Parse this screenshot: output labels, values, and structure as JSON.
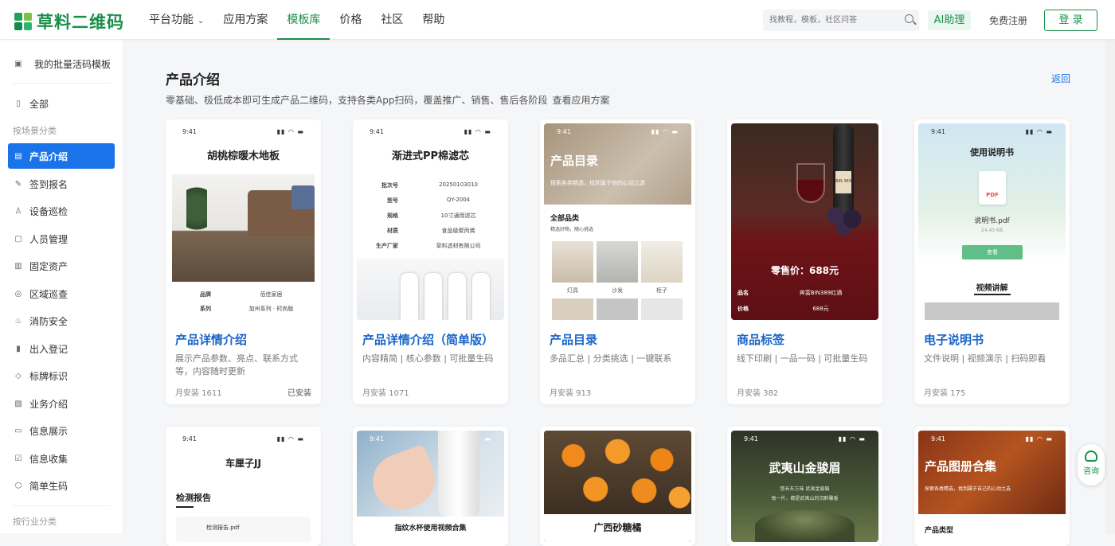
{
  "header": {
    "logo_text": "草料二维码",
    "nav": [
      {
        "label": "平台功能",
        "has_dropdown": true
      },
      {
        "label": "应用方案"
      },
      {
        "label": "模板库",
        "active": true
      },
      {
        "label": "价格"
      },
      {
        "label": "社区"
      },
      {
        "label": "帮助"
      }
    ],
    "search_placeholder": "找教程，模板，社区问答",
    "ai_label": "AI助理",
    "register_label": "免费注册",
    "login_label": "登 录"
  },
  "sidebar": {
    "top_item": "我的批量活码模板",
    "all_item": "全部",
    "category_scene": "按场景分类",
    "items": [
      {
        "label": "产品介绍",
        "active": true
      },
      {
        "label": "签到报名"
      },
      {
        "label": "设备巡检"
      },
      {
        "label": "人员管理"
      },
      {
        "label": "固定资产"
      },
      {
        "label": "区域巡查"
      },
      {
        "label": "消防安全"
      },
      {
        "label": "出入登记"
      },
      {
        "label": "标牌标识"
      },
      {
        "label": "业务介绍"
      },
      {
        "label": "信息展示"
      },
      {
        "label": "信息收集"
      },
      {
        "label": "简单生码"
      }
    ],
    "category_industry": "按行业分类"
  },
  "page": {
    "title": "产品介绍",
    "subtitle": "零基础、极低成本即可生成产品二维码，支持各类App扫码，覆盖推广、销售、售后各阶段",
    "subtitle_link": "查看应用方案",
    "back_label": "返回"
  },
  "cards": [
    {
      "title": "产品详情介绍",
      "desc": "展示产品参数、亮点、联系方式等，内容随时更新",
      "installs": "月安装  1611",
      "installed": "已安装",
      "preview": {
        "time": "9:41",
        "heading": "胡桃棕暖木地板",
        "rows": [
          [
            "品牌",
            "佰佳家居"
          ],
          [
            "系列",
            "加州系列 · 时尚版"
          ]
        ]
      }
    },
    {
      "title": "产品详情介绍（简单版）",
      "desc": "内容精简 | 核心参数 | 可批量生码",
      "installs": "月安装  1071",
      "preview": {
        "time": "9:41",
        "heading": "渐进式PP棉滤芯",
        "rows": [
          [
            "批次号",
            "20250103010"
          ],
          [
            "型号",
            "QY-2004"
          ],
          [
            "规格",
            "10寸通用滤芯"
          ],
          [
            "材质",
            "食品级聚丙烯"
          ],
          [
            "生产厂家",
            "草料滤材有限公司"
          ]
        ]
      }
    },
    {
      "title": "产品目录",
      "desc": "多品汇总 | 分类挑选 | 一键联系",
      "installs": "月安装  913",
      "preview": {
        "time": "9:41",
        "banner_title": "产品目录",
        "banner_sub": "探索各类精选，找到属于你的心动之选",
        "section": "全部品类",
        "section_sub": "精选好物，随心挑选",
        "thumbs": [
          "灯具",
          "沙发",
          "柜子"
        ]
      }
    },
    {
      "title": "商品标签",
      "desc": "线下印刷 | 一品一码 | 可批量生码",
      "installs": "月安装  382",
      "preview": {
        "price": "零售价：688元",
        "rows": [
          [
            "品名",
            "奔富BIN389红酒"
          ],
          [
            "价格",
            "688元"
          ]
        ],
        "bottle_label": "BIN 389"
      }
    },
    {
      "title": "电子说明书",
      "desc": "文件说明 | 视频演示 | 扫码即看",
      "installs": "月安装  175",
      "preview": {
        "time": "9:41",
        "heading": "使用说明书",
        "file_badge": "PDF",
        "file_name": "说明书.pdf",
        "file_size": "24.43 KB",
        "view_btn": "查看",
        "video_title": "视频讲解"
      }
    }
  ],
  "cards_row2": [
    {
      "time": "9:41",
      "heading": "车厘子JJ",
      "section": "检测报告",
      "file": "检测报告.pdf"
    },
    {
      "time": "9:41",
      "caption": "指纹水杯使用视频合集"
    },
    {
      "caption": "广西砂糖橘"
    },
    {
      "time": "9:41",
      "heading": "武夷山金骏眉",
      "sub1": "悠长东方味 武夷金骏眉",
      "sub2": "每一片，都是武夷山的沉醉馨香"
    },
    {
      "time": "9:41",
      "heading": "产品图册合集",
      "sub": "探索各类精选，找到属于自己的心动之选",
      "section": "产品类型"
    }
  ],
  "help": {
    "label": "咨询"
  },
  "colors": {
    "brand": "#1a8f4a",
    "accent": "#1a73e8",
    "title_blue": "#1a64c8"
  }
}
